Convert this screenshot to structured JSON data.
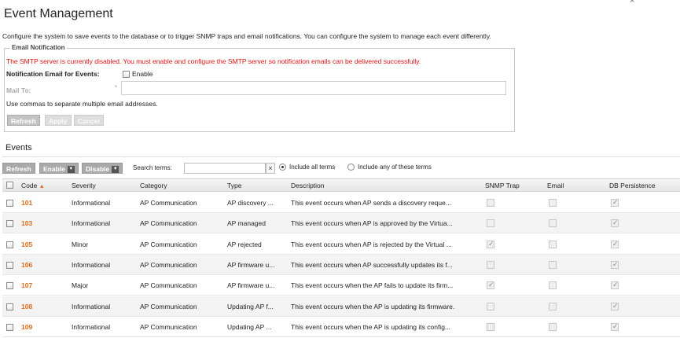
{
  "page": {
    "title": "Event Management",
    "close_icon": "×",
    "intro": "Configure the system to save events to the database or to trigger SNMP traps and email notifications. You can configure the system to manage each event differently."
  },
  "email": {
    "legend": "Email Notification",
    "warning": "The SMTP server is currently disabled. You must enable and configure the SMTP server so notification emails can be delivered successfully.",
    "notif_label": "Notification Email for Events:",
    "enable_label": "Enable",
    "mailto_label": "Mail To:",
    "required_star": "*",
    "mailto_value": "",
    "hint": "Use commas to separate multiple email addresses.",
    "buttons": {
      "refresh": "Refresh",
      "apply": "Apply",
      "cancel": "Cancel"
    }
  },
  "events": {
    "heading": "Events",
    "toolbar": {
      "refresh": "Refresh",
      "enable": "Enable",
      "disable": "Disable",
      "search_label": "Search terms:",
      "search_value": "",
      "clear": "×",
      "include_all": "Include all terms",
      "include_any": "Include any of these terms"
    },
    "columns": {
      "code": "Code",
      "severity": "Severity",
      "category": "Category",
      "type": "Type",
      "description": "Description",
      "snmp": "SNMP Trap",
      "email": "Email",
      "db": "DB Persistence"
    },
    "rows": [
      {
        "code": "101",
        "severity": "Informational",
        "category": "AP Communication",
        "type": "AP discovery ...",
        "description": "This event occurs when AP sends a discovery reque...",
        "snmp": false,
        "email": false,
        "db": true
      },
      {
        "code": "103",
        "severity": "Informational",
        "category": "AP Communication",
        "type": "AP managed",
        "description": "This event occurs when AP is approved by the Virtua...",
        "snmp": false,
        "email": false,
        "db": true
      },
      {
        "code": "105",
        "severity": "Minor",
        "category": "AP Communication",
        "type": "AP rejected",
        "description": "This event occurs when AP is rejected by the Virtual ...",
        "snmp": true,
        "email": false,
        "db": true
      },
      {
        "code": "106",
        "severity": "Informational",
        "category": "AP Communication",
        "type": "AP firmware u...",
        "description": "This event occurs when AP successfully updates its f...",
        "snmp": false,
        "email": false,
        "db": true
      },
      {
        "code": "107",
        "severity": "Major",
        "category": "AP Communication",
        "type": "AP firmware u...",
        "description": "This event occurs when the AP fails to update its firm...",
        "snmp": true,
        "email": false,
        "db": true
      },
      {
        "code": "108",
        "severity": "Informational",
        "category": "AP Communication",
        "type": "Updating AP f...",
        "description": "This event occurs when the AP is updating its firmware.",
        "snmp": false,
        "email": false,
        "db": true
      },
      {
        "code": "109",
        "severity": "Informational",
        "category": "AP Communication",
        "type": "Updating AP ...",
        "description": "This event occurs when the AP is updating its config...",
        "snmp": false,
        "email": false,
        "db": true
      }
    ]
  }
}
